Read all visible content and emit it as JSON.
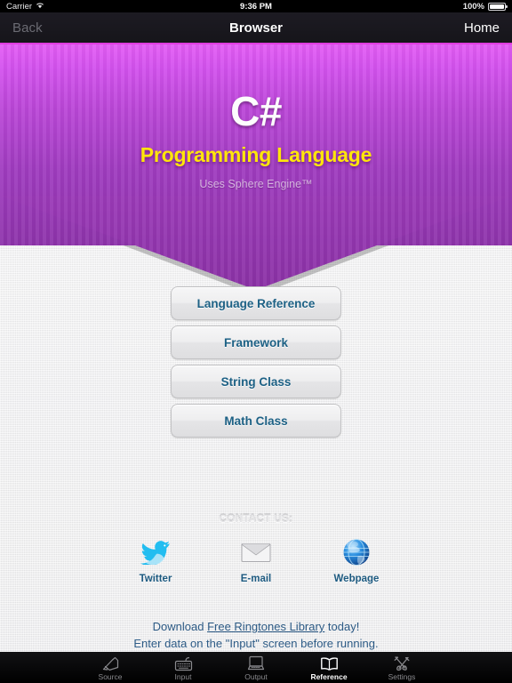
{
  "status_bar": {
    "carrier": "Carrier",
    "wifi_icon": "wifi-icon",
    "time": "9:36 PM",
    "battery_percent": "100%",
    "battery_icon": "battery-full-icon"
  },
  "nav_bar": {
    "back_label": "Back",
    "title": "Browser",
    "home_label": "Home",
    "accent_color": "#e03ce0"
  },
  "banner": {
    "language": "C#",
    "subtitle": "Programming Language",
    "engine": "Uses Sphere Engine™",
    "gradient_top": "#e45df5",
    "gradient_bottom": "#8e34ab",
    "subtitle_color": "#ffe60a"
  },
  "menu": {
    "buttons": [
      {
        "label": "Language Reference",
        "name": "menu-button-language-reference"
      },
      {
        "label": "Framework",
        "name": "menu-button-framework"
      },
      {
        "label": "String Class",
        "name": "menu-button-string-class"
      },
      {
        "label": "Math Class",
        "name": "menu-button-math-class"
      }
    ],
    "text_color": "#1d6185"
  },
  "contact": {
    "title": "CONTACT US:",
    "items": [
      {
        "label": "Twitter",
        "icon": "twitter-bird-icon"
      },
      {
        "label": "E-mail",
        "icon": "envelope-icon"
      },
      {
        "label": "Webpage",
        "icon": "globe-icon"
      }
    ]
  },
  "notes": {
    "line1_prefix": "Download ",
    "line1_link": "Free Ringtones Library",
    "line1_suffix": " today!",
    "line2": "Enter data on the \"Input\" screen before running."
  },
  "tab_bar": {
    "tabs": [
      {
        "label": "Source",
        "icon": "pen-tablet-icon",
        "active": false
      },
      {
        "label": "Input",
        "icon": "keyboard-icon",
        "active": false
      },
      {
        "label": "Output",
        "icon": "monitor-icon",
        "active": false
      },
      {
        "label": "Reference",
        "icon": "open-book-icon",
        "active": true
      },
      {
        "label": "Settings",
        "icon": "tools-icon",
        "active": false
      }
    ]
  }
}
